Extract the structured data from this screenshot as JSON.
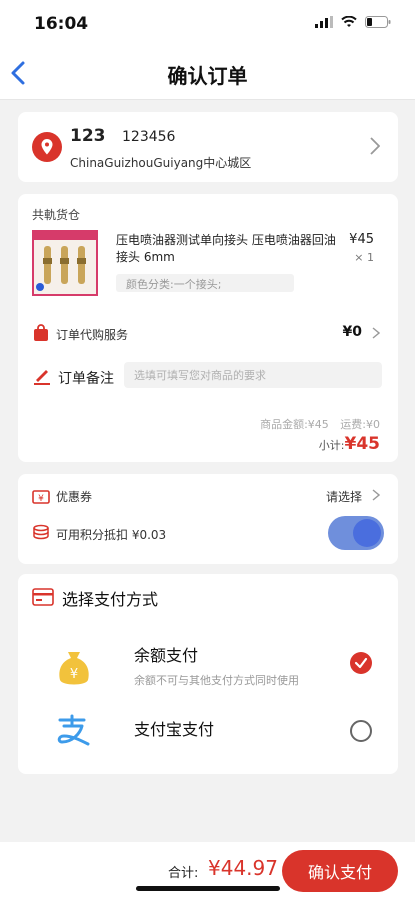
{
  "status": {
    "time": "16:04"
  },
  "nav": {
    "title": "确认订单"
  },
  "address": {
    "name": "123",
    "phone": "123456",
    "detail": "ChinaGuizhouGuiyang中心城区"
  },
  "order": {
    "warehouse": "共軌货仓",
    "product": {
      "title": "压电喷油器测试单向接头 压电喷油器回油接头 6mm",
      "spec": "颜色分类:一个接头;",
      "price": "¥45",
      "qty": "× 1"
    },
    "service": {
      "label": "订单代购服务",
      "value": "¥0"
    },
    "note": {
      "label": "订单备注",
      "placeholder": "选填可填写您对商品的要求"
    },
    "goods_amount": "商品金额:¥45",
    "shipping": "运费:¥0",
    "subtotal_label": "小计:",
    "subtotal_value": "¥45"
  },
  "discounts": {
    "coupon_label": "优惠券",
    "coupon_select": "请选择",
    "points_label": "可用积分抵扣 ¥0.03",
    "points_enabled": true
  },
  "payment": {
    "header": "选择支付方式",
    "methods": [
      {
        "title": "余额支付",
        "subtitle": "余额不可与其他支付方式同时使用",
        "selected": true
      },
      {
        "title": "支付宝支付",
        "selected": false
      }
    ]
  },
  "footer": {
    "total_label": "合计:",
    "total_value": "¥44.97",
    "confirm_label": "确认支付"
  },
  "colors": {
    "accent": "#d9342b",
    "toggle": "#4a6ede"
  }
}
